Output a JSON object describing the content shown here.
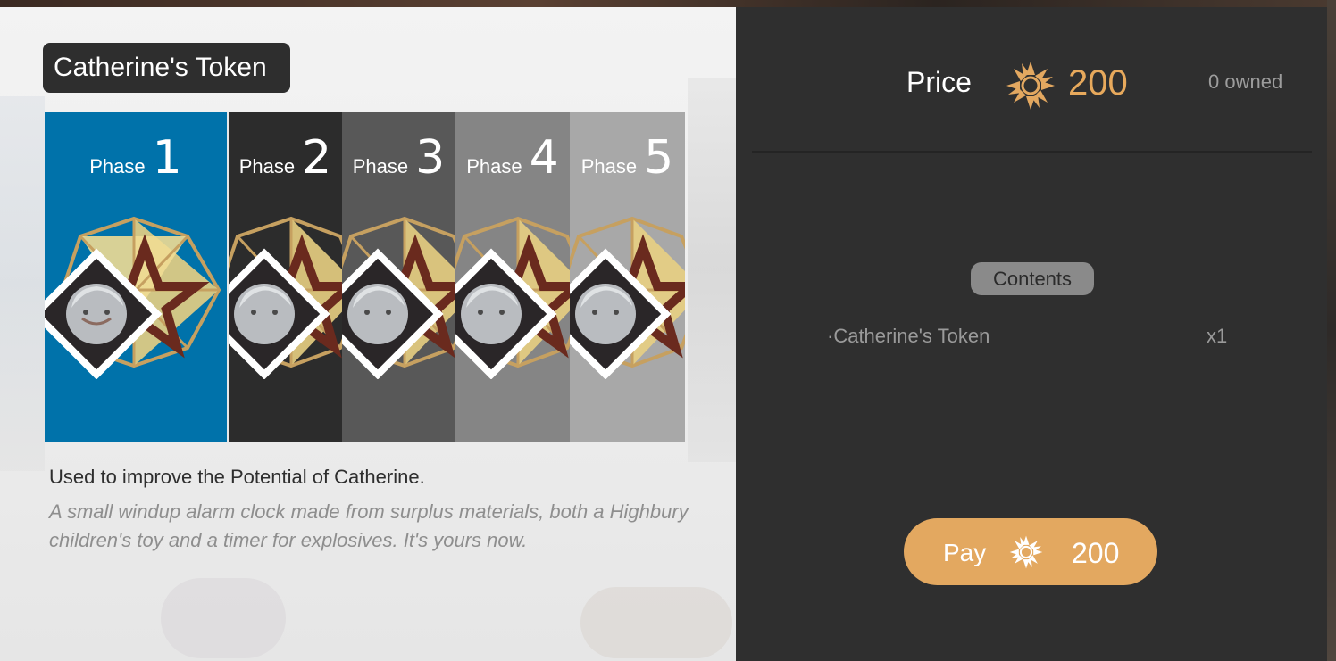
{
  "item": {
    "title": "Catherine's Token",
    "description": "Used to improve the Potential of Catherine.",
    "flavor_text": "A small windup alarm clock made from surplus materials, both a Highbury children's toy and a timer for explosives. It's yours now."
  },
  "phases": [
    {
      "word": "Phase",
      "number": "1",
      "bg": "#0072aa"
    },
    {
      "word": "Phase",
      "number": "2",
      "bg": "#2c2c2c"
    },
    {
      "word": "Phase",
      "number": "3",
      "bg": "#585858"
    },
    {
      "word": "Phase",
      "number": "4",
      "bg": "#858585"
    },
    {
      "word": "Phase",
      "number": "5",
      "bg": "#a8a8a8"
    }
  ],
  "shop": {
    "price_label": "Price",
    "price_value": "200",
    "owned": "0 owned",
    "currency_icon": "sun-currency-icon",
    "accent_color": "#e3a860",
    "contents_label": "Contents",
    "contents": [
      {
        "name": "·Catherine's Token",
        "qty": "x1"
      }
    ],
    "pay_label": "Pay",
    "pay_amount": "200"
  }
}
